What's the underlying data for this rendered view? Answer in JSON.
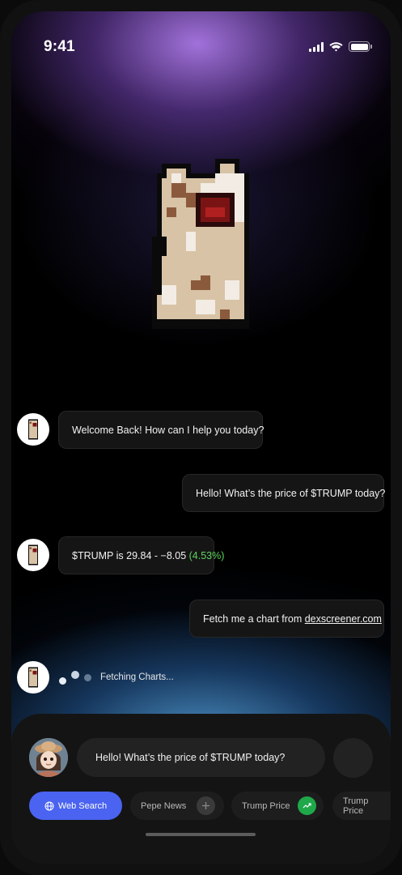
{
  "status_bar": {
    "time": "9:41",
    "icons": [
      "signal-icon",
      "wifi-icon",
      "battery-icon"
    ]
  },
  "mascot": {
    "icon": "pixel-cat-icon"
  },
  "chat": {
    "messages": [
      {
        "sender": "bot",
        "text": "Welcome Back! How can I help you today?"
      },
      {
        "sender": "user",
        "text": "Hello! What’s the price of $TRUMP today?"
      },
      {
        "sender": "bot",
        "text_prefix": "$TRUMP is 29.84 - −8.05 ",
        "text_change": "(4.53%)"
      },
      {
        "sender": "user",
        "text_prefix": "Fetch me a chart from ",
        "link": "dexscreener.com"
      }
    ],
    "status": "Fetching Charts..."
  },
  "composer": {
    "input_value": "Hello! What’s the price of $TRUMP today?"
  },
  "chips": [
    {
      "label": "Web Search",
      "icon": "globe-icon"
    },
    {
      "label": "Pepe News",
      "icon": "plus-icon"
    },
    {
      "label": "Trump Price",
      "icon": "trend-up-icon"
    },
    {
      "label": "Trump Price"
    }
  ],
  "colors": {
    "accent": "#4a63f0",
    "positive": "#5fd35f",
    "trend_badge": "#1fa84a"
  }
}
